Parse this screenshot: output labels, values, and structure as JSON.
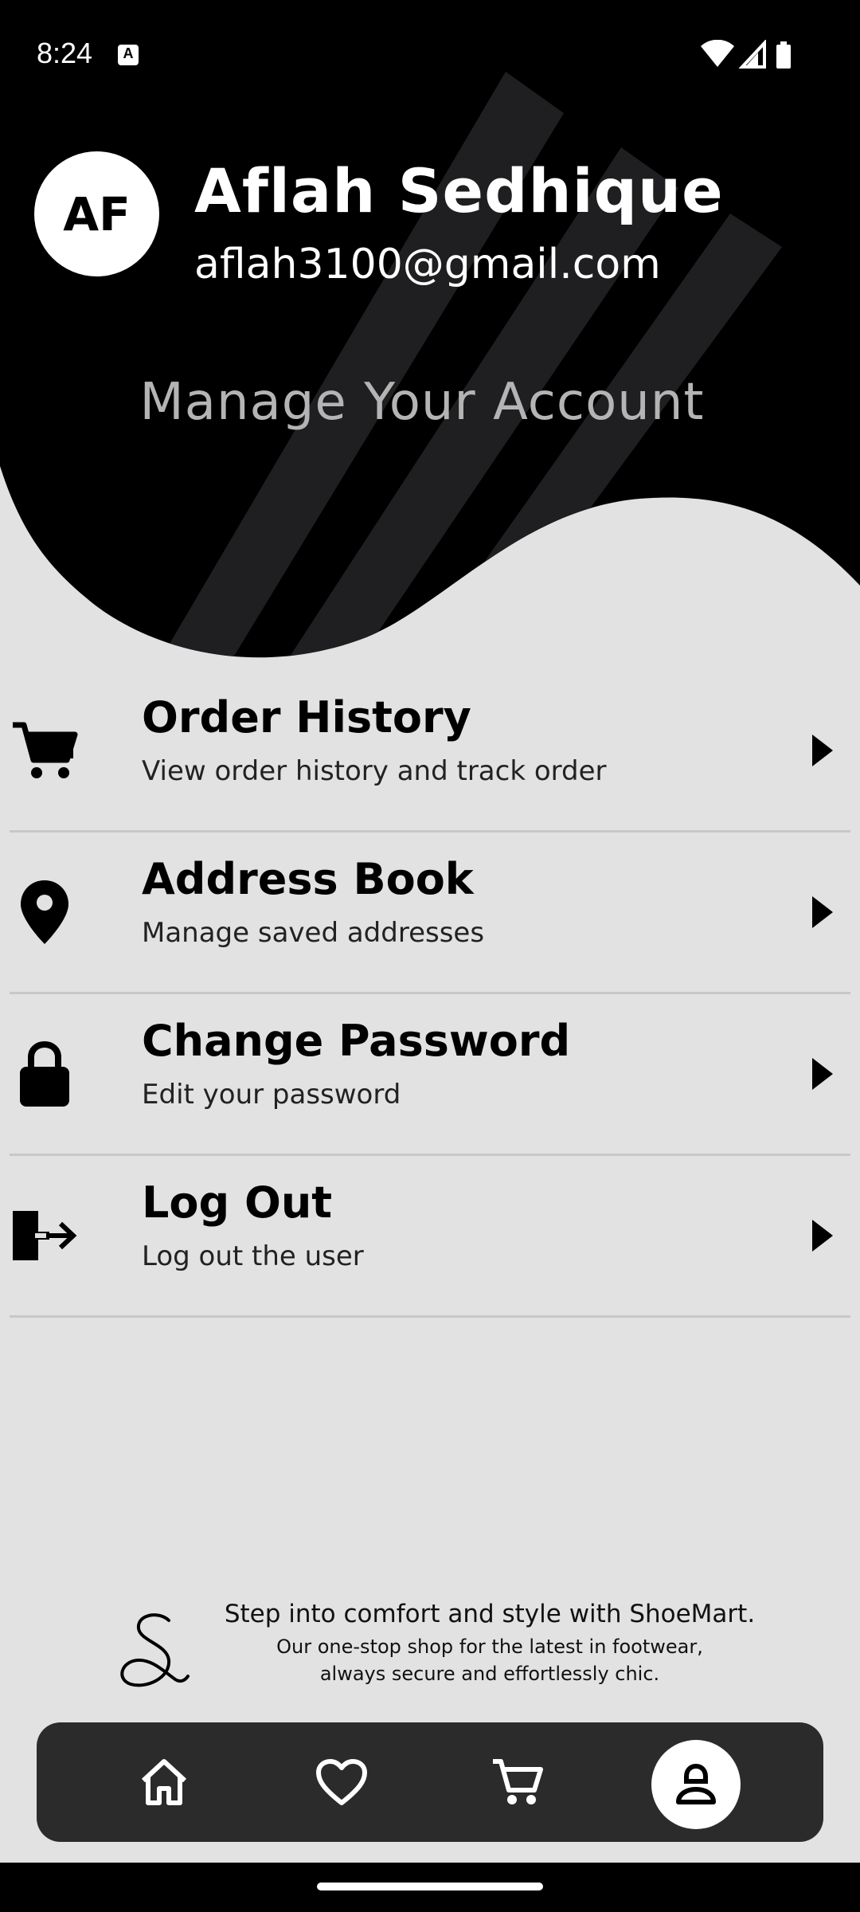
{
  "status_bar": {
    "time": "8:24",
    "notification_icon": "A"
  },
  "profile": {
    "initials": "AF",
    "name": "Aflah Sedhique",
    "email": "aflah3100@gmail.com"
  },
  "header": {
    "title": "Manage Your Account"
  },
  "menu": {
    "items": [
      {
        "title": "Order History",
        "subtitle": "View order history and track order",
        "icon": "cart-icon"
      },
      {
        "title": "Address Book",
        "subtitle": "Manage saved addresses",
        "icon": "location-pin-icon"
      },
      {
        "title": "Change Password",
        "subtitle": "Edit your password",
        "icon": "lock-icon"
      },
      {
        "title": "Log Out",
        "subtitle": "Log out the user",
        "icon": "logout-icon"
      }
    ]
  },
  "footer": {
    "tagline": "Step into comfort and style with ShoeMart.",
    "description_line1": "Our one-stop shop for the latest in footwear,",
    "description_line2": "always secure and effortlessly chic."
  },
  "bottom_nav": {
    "items": [
      "home-icon",
      "heart-icon",
      "cart-icon",
      "profile-icon"
    ],
    "active": "profile-icon"
  },
  "colors": {
    "header_bg": "#000000",
    "page_bg": "#e2e2e2",
    "stripe": "#1f1f21",
    "nav_bg": "#2b2b2b",
    "subtitle_gray": "#b4b4b4"
  }
}
